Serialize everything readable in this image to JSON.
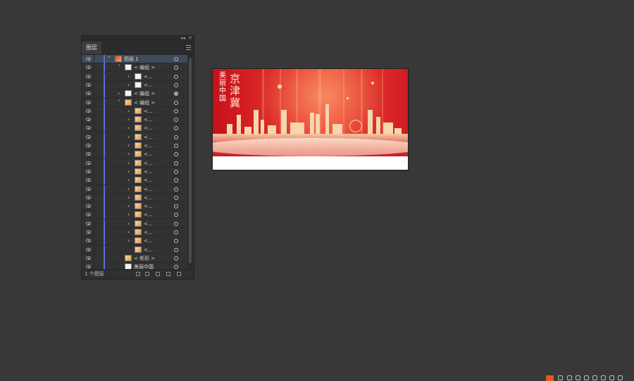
{
  "panel": {
    "tab_label": "图层",
    "collapse_glyph": "◂◂",
    "close_glyph": "✕",
    "footer_label": "1 个图层",
    "rows": [
      {
        "label": "图层 1",
        "level": 0,
        "twisty": "v",
        "thumb": "red",
        "selected": true,
        "target_filled": false
      },
      {
        "label": "< 编组 >",
        "level": 1,
        "twisty": "v",
        "thumb": "white",
        "selected": false,
        "target_filled": false
      },
      {
        "label": "<...",
        "level": 2,
        "twisty": ">",
        "thumb": "white",
        "selected": false,
        "target_filled": false
      },
      {
        "label": "<...",
        "level": 2,
        "twisty": ">",
        "thumb": "white",
        "selected": false,
        "target_filled": false
      },
      {
        "label": "< 编组 >",
        "level": 1,
        "twisty": ">",
        "thumb": "white",
        "selected": false,
        "target_filled": true
      },
      {
        "label": "< 编组 >",
        "level": 1,
        "twisty": "v",
        "thumb": "img",
        "selected": false,
        "target_filled": false
      },
      {
        "label": "<...",
        "level": 2,
        "twisty": ">",
        "thumb": "img",
        "selected": false,
        "target_filled": false
      },
      {
        "label": "<...",
        "level": 2,
        "twisty": ">",
        "thumb": "img",
        "selected": false,
        "target_filled": false
      },
      {
        "label": "<...",
        "level": 2,
        "twisty": ">",
        "thumb": "img",
        "selected": false,
        "target_filled": false
      },
      {
        "label": "<...",
        "level": 2,
        "twisty": ">",
        "thumb": "img",
        "selected": false,
        "target_filled": false
      },
      {
        "label": "<...",
        "level": 2,
        "twisty": ">",
        "thumb": "img",
        "selected": false,
        "target_filled": false
      },
      {
        "label": "<...",
        "level": 2,
        "twisty": ">",
        "thumb": "img",
        "selected": false,
        "target_filled": false
      },
      {
        "label": "<...",
        "level": 2,
        "twisty": ">",
        "thumb": "img",
        "selected": false,
        "target_filled": false
      },
      {
        "label": "<...",
        "level": 2,
        "twisty": ">",
        "thumb": "img",
        "selected": false,
        "target_filled": false
      },
      {
        "label": "<...",
        "level": 2,
        "twisty": ">",
        "thumb": "img",
        "selected": false,
        "target_filled": false
      },
      {
        "label": "<...",
        "level": 2,
        "twisty": ">",
        "thumb": "img",
        "selected": false,
        "target_filled": false
      },
      {
        "label": "<...",
        "level": 2,
        "twisty": ">",
        "thumb": "img",
        "selected": false,
        "target_filled": false
      },
      {
        "label": "<...",
        "level": 2,
        "twisty": ">",
        "thumb": "img",
        "selected": false,
        "target_filled": false
      },
      {
        "label": "<...",
        "level": 2,
        "twisty": ">",
        "thumb": "img",
        "selected": false,
        "target_filled": false
      },
      {
        "label": "<...",
        "level": 2,
        "twisty": ">",
        "thumb": "img",
        "selected": false,
        "target_filled": false
      },
      {
        "label": "<...",
        "level": 2,
        "twisty": ">",
        "thumb": "img",
        "selected": false,
        "target_filled": false
      },
      {
        "label": "<...",
        "level": 2,
        "twisty": ">",
        "thumb": "img",
        "selected": false,
        "target_filled": false
      },
      {
        "label": "<...",
        "level": 2,
        "twisty": "",
        "thumb": "img",
        "selected": false,
        "target_filled": false
      },
      {
        "label": "< 矩形 >",
        "level": 1,
        "twisty": "",
        "thumb": "img",
        "selected": false,
        "target_filled": false
      },
      {
        "label": "美丽中国",
        "level": 1,
        "twisty": "",
        "thumb": "white",
        "selected": false,
        "target_filled": false
      }
    ]
  },
  "artboard": {
    "title_small": "美丽中国",
    "title_big": "京津冀",
    "caption": "…"
  },
  "colors": {
    "background": "#383838",
    "panel": "#323232",
    "layer_color_bar": "#4f73d9",
    "selected_row": "#3e4c5c",
    "banner_red": "#d11a20"
  }
}
